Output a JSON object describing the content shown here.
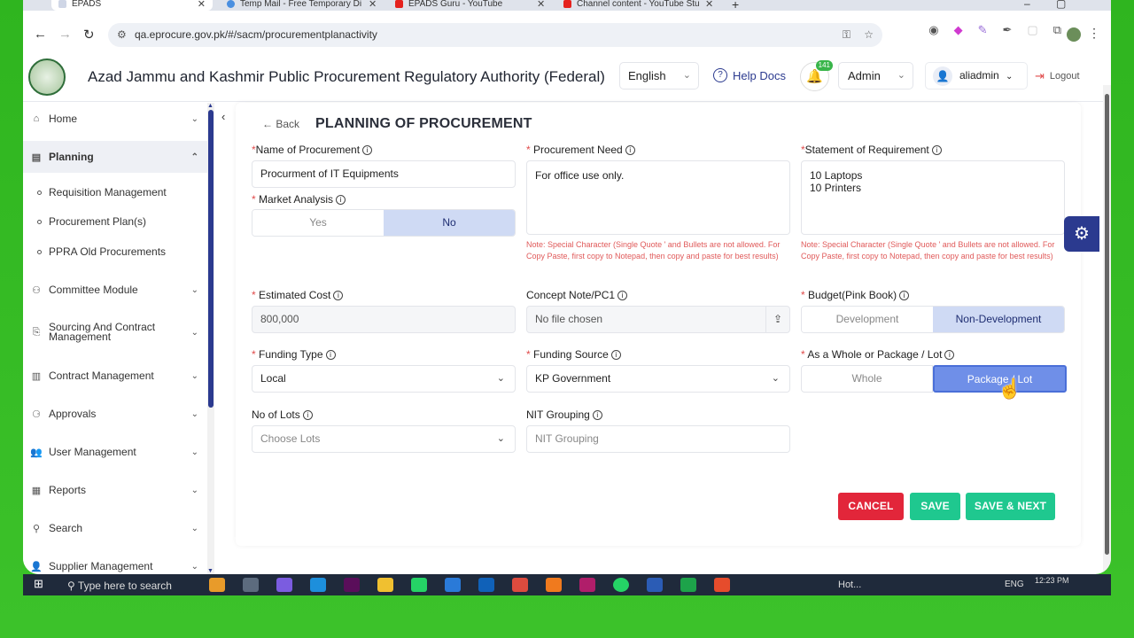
{
  "browser": {
    "tabs": [
      {
        "label": "EPADS"
      },
      {
        "label": "Temp Mail - Free Temporary Di"
      },
      {
        "label": "EPADS Guru - YouTube"
      },
      {
        "label": "Channel content - YouTube Stu"
      }
    ],
    "url": "qa.eprocure.gov.pk/#/sacm/procurementplanactivity"
  },
  "header": {
    "title": "Azad Jammu and Kashmir Public Procurement Regulatory Authority (Federal)",
    "language": "English",
    "help_label": "Help Docs",
    "notification_count": "141",
    "role": "Admin",
    "username": "aliadmin",
    "logout_label": "Logout"
  },
  "sidebar": {
    "items": [
      {
        "label": "Home"
      },
      {
        "label": "Planning"
      },
      {
        "label": "Committee Module"
      },
      {
        "label": "Sourcing And Contract Management"
      },
      {
        "label": "Contract Management"
      },
      {
        "label": "Approvals"
      },
      {
        "label": "User Management"
      },
      {
        "label": "Reports"
      },
      {
        "label": "Search"
      },
      {
        "label": "Supplier Management"
      }
    ],
    "sub_items": [
      {
        "label": "Requisition Management"
      },
      {
        "label": "Procurement Plan(s)"
      },
      {
        "label": "PPRA Old Procurements"
      }
    ]
  },
  "form": {
    "back_label": "Back",
    "page_title": "PLANNING OF PROCUREMENT",
    "name_label": "Name of Procurement",
    "name_value": "Procurment of IT Equipments",
    "need_label": "Procurement Need",
    "need_value": "For office use only.",
    "sor_label": "Statement of Requirement",
    "sor_value": "10 Laptops\n10 Printers",
    "market_label": "Market Analysis",
    "market_yes": "Yes",
    "market_no": "No",
    "note_text": "Note: Special Character (Single Quote ' and Bullets are not allowed. For Copy Paste, first copy to Notepad, then copy and paste for best results)",
    "cost_label": "Estimated Cost",
    "cost_value": "800,000",
    "concept_label": "Concept Note/PC1",
    "concept_value": "No file chosen",
    "budget_label": "Budget(Pink Book)",
    "budget_dev": "Development",
    "budget_nondev": "Non-Development",
    "funding_type_label": "Funding Type",
    "funding_type_value": "Local",
    "funding_source_label": "Funding Source",
    "funding_source_value": "KP Government",
    "whole_label": "As a Whole or Package / Lot",
    "whole_opt": "Whole",
    "package_opt": "Package / Lot",
    "lots_label": "No of Lots",
    "lots_placeholder": "Choose Lots",
    "nit_label": "NIT Grouping",
    "nit_placeholder": "NIT Grouping",
    "cancel_label": "CANCEL",
    "save_label": "SAVE",
    "save_next_label": "SAVE & NEXT"
  },
  "taskbar": {
    "search_placeholder": "Type here to search",
    "weather": "Hot...",
    "lang": "ENG",
    "time": "12:23 PM"
  },
  "colors": {
    "brand": "#2b3a8f",
    "cancel": "#e2263a",
    "save": "#1fc88f",
    "selected": "#cfdaf4"
  }
}
